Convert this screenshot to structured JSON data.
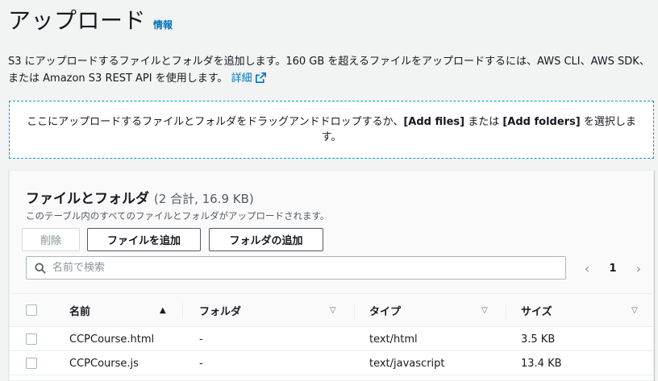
{
  "header": {
    "title": "アップロード",
    "info_link": "情報"
  },
  "description": {
    "text": "S3 にアップロードするファイルとフォルダを追加します。160 GB を超えるファイルをアップロードするには、AWS CLI、AWS SDK、または Amazon S3 REST API を使用します。",
    "detail_link": "詳細",
    "detail_icon": "external-link-icon"
  },
  "dropzone": {
    "text_before": "ここにアップロードするファイルとフォルダをドラッグアンドドロップするか、",
    "add_files": "[Add files]",
    "text_middle": " または ",
    "add_folders": "[Add folders]",
    "text_after": " を選択します。"
  },
  "files_panel": {
    "title": "ファイルとフォルダ",
    "count": "(2 合計, 16.9 KB)",
    "description": "このテーブル内のすべてのファイルとフォルダがアップロードされます。",
    "buttons": {
      "delete": "削除",
      "add_files": "ファイルを追加",
      "add_folder": "フォルダの追加"
    },
    "search": {
      "placeholder": "名前で検索",
      "icon": "search-icon"
    },
    "pagination": {
      "prev": "‹",
      "page": "1",
      "next": "›"
    },
    "columns": [
      {
        "label": "名前",
        "sort": "▲"
      },
      {
        "label": "フォルダ",
        "sort": "▽"
      },
      {
        "label": "タイプ",
        "sort": "▽"
      },
      {
        "label": "サイズ",
        "sort": "▽"
      }
    ],
    "rows": [
      {
        "name": "CCPCourse.html",
        "folder": "-",
        "type": "text/html",
        "size": "3.5 KB"
      },
      {
        "name": "CCPCourse.js",
        "folder": "-",
        "type": "text/javascript",
        "size": "13.4 KB"
      }
    ]
  },
  "colors": {
    "link": "#0073bb",
    "dropzone_border": "#00a1c9",
    "background": "#f2f3f3"
  }
}
